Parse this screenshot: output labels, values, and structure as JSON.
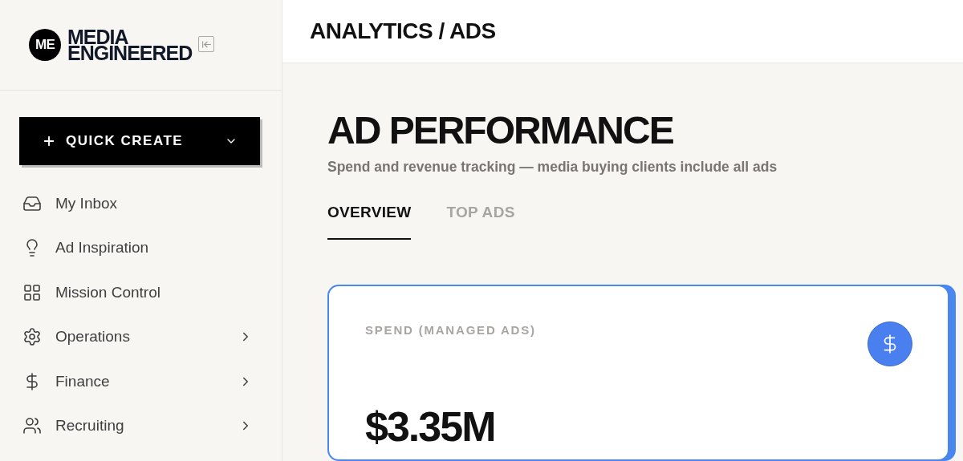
{
  "sidebar": {
    "logo": {
      "badge": "ME",
      "line_1": "MEDIA",
      "line_2": "ENGINEERED"
    },
    "quick_create": {
      "label": "QUICK CREATE"
    },
    "items": [
      {
        "label": "My Inbox",
        "kind": "inbox",
        "expandable": false
      },
      {
        "label": "Ad Inspiration",
        "kind": "bulb",
        "expandable": false
      },
      {
        "label": "Mission Control",
        "kind": "grid",
        "expandable": false
      },
      {
        "label": "Operations",
        "kind": "gear",
        "expandable": true
      },
      {
        "label": "Finance",
        "kind": "dollar",
        "expandable": true
      },
      {
        "label": "Recruiting",
        "kind": "people",
        "expandable": true
      }
    ]
  },
  "header": {
    "breadcrumb": "ANALYTICS / ADS"
  },
  "page": {
    "title": "AD PERFORMANCE",
    "subtitle": "Spend and revenue tracking — media buying clients include all ads",
    "tabs": [
      {
        "label": "OVERVIEW",
        "selected": true
      },
      {
        "label": "TOP ADS",
        "selected": false
      }
    ],
    "card": {
      "label": "SPEND (MANAGED ADS)",
      "value": "$3.35M"
    }
  }
}
